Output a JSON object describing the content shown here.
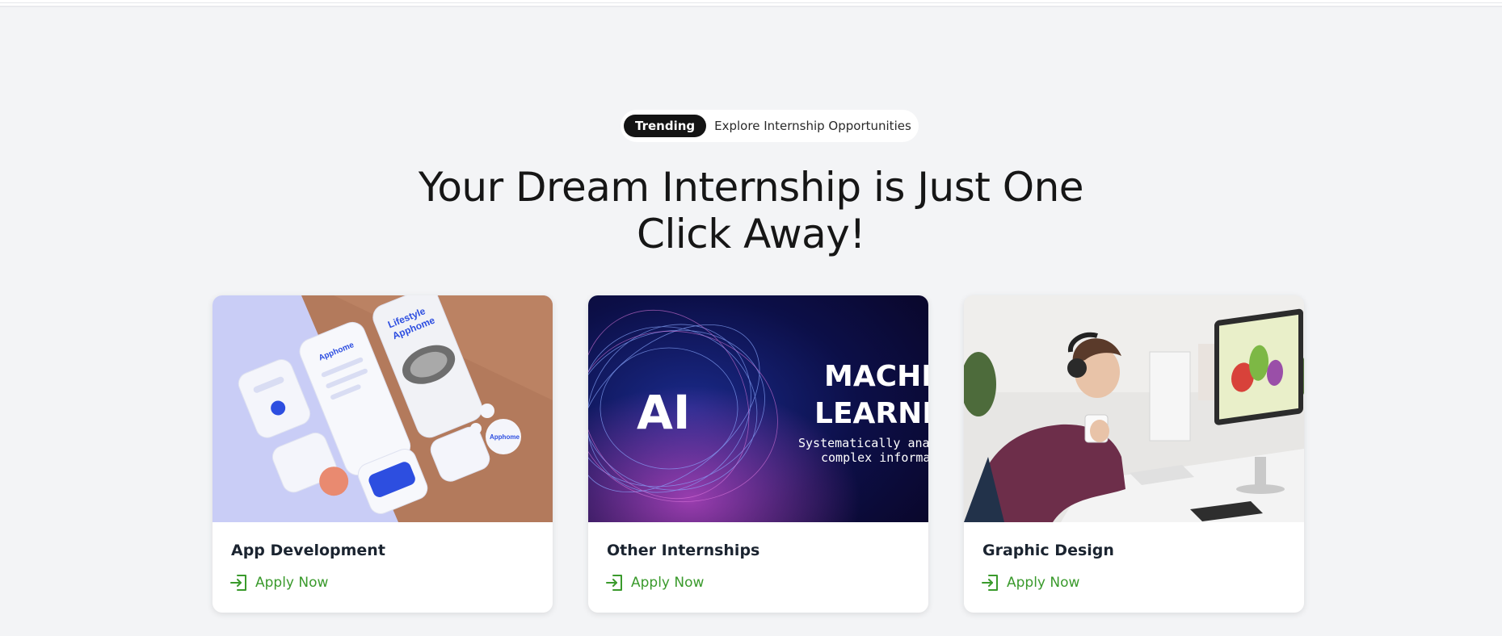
{
  "header": {
    "badge_label": "Trending",
    "badge_text": "Explore Internship Opportunities",
    "headline_line1": "Your Dream Internship is Just One",
    "headline_line2": "Click Away!"
  },
  "cards": [
    {
      "title": "App Development",
      "apply_label": "Apply Now",
      "image": "app-mockups-image"
    },
    {
      "title": "Other Internships",
      "apply_label": "Apply Now",
      "image": "ai-machine-learning-image",
      "image_text": {
        "ai": "AI",
        "line1": "MACHIN",
        "line2": "LEARNING",
        "sub1": "Systematically analyzi",
        "sub2": "complex informati"
      }
    },
    {
      "title": "Graphic Design",
      "apply_label": "Apply Now",
      "image": "designer-at-monitor-image"
    }
  ],
  "colors": {
    "page_bg": "#f3f4f6",
    "badge_bg": "#141414",
    "apply_green": "#3a9a2c",
    "title_text": "#1b2430"
  },
  "icons": {
    "apply": "sign-in-icon"
  }
}
